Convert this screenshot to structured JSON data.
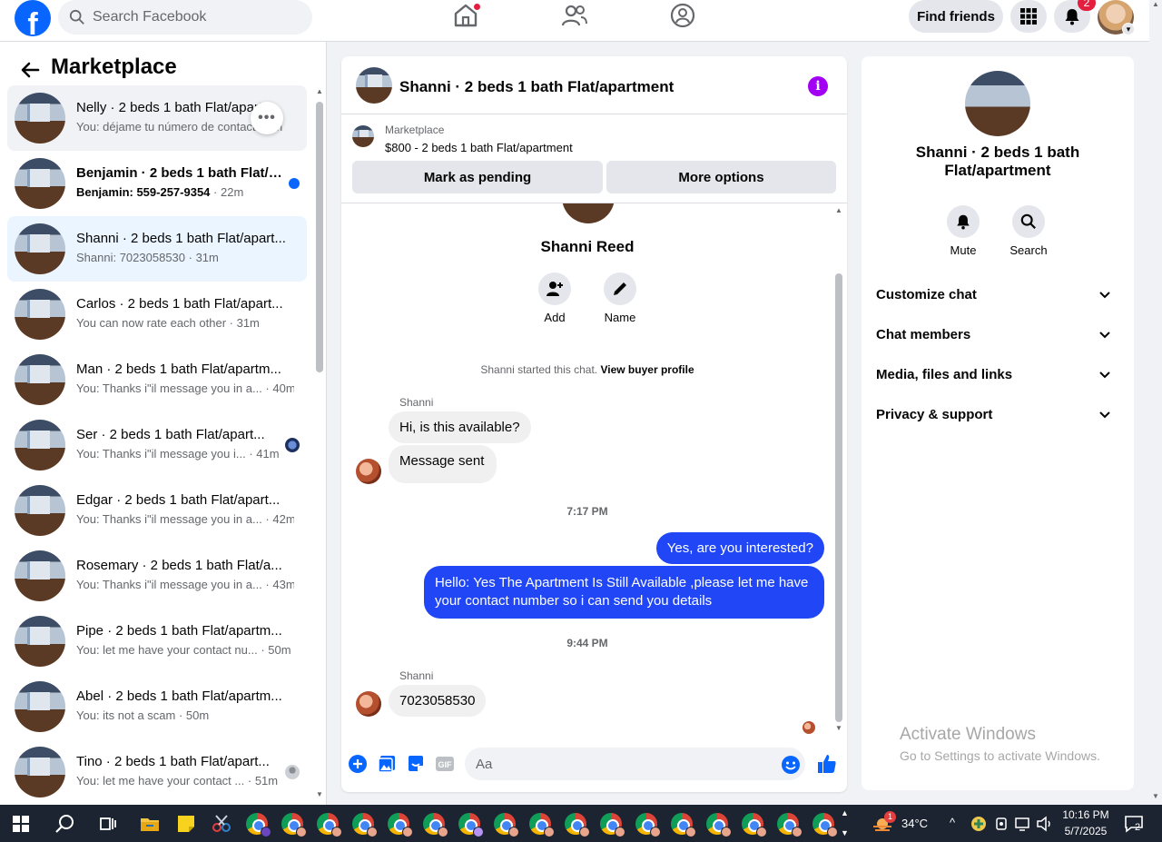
{
  "topnav": {
    "logo_letter": "f",
    "search_placeholder": "Search Facebook",
    "find_friends": "Find friends",
    "notification_count": "2"
  },
  "sidebar": {
    "title": "Marketplace",
    "conversations": [
      {
        "title": "Nelly · 2 beds 1 bath Flat/apartment",
        "preview": "You: déjame tu número de contacto",
        "time": "m",
        "state": "hover"
      },
      {
        "title": "Benjamin · 2 beds 1 bath Flat/apartment",
        "preview": "Benjamin: 559-257-9354",
        "time": "22m",
        "state": "unread"
      },
      {
        "title": "Shanni · 2 beds 1 bath Flat/apart...",
        "preview": "Shanni: 7023058530",
        "time": "31m",
        "state": "active"
      },
      {
        "title": "Carlos · 2 beds 1 bath Flat/apart...",
        "preview": "You can now rate each other",
        "time": "31m",
        "state": ""
      },
      {
        "title": "Man · 2 beds 1 bath Flat/apartm...",
        "preview": "You: Thanks i\"il message you in a...",
        "time": "40m",
        "state": ""
      },
      {
        "title": "Ser · 2 beds 1 bath Flat/apart...",
        "preview": "You: Thanks i\"il message you i...",
        "time": "41m",
        "state": "seen"
      },
      {
        "title": "Edgar · 2 beds 1 bath Flat/apart...",
        "preview": "You: Thanks i\"il message you in a...",
        "time": "42m",
        "state": ""
      },
      {
        "title": "Rosemary · 2 beds 1 bath Flat/a...",
        "preview": "You: Thanks i\"il message you in a...",
        "time": "43m",
        "state": ""
      },
      {
        "title": "Pipe · 2 beds 1 bath Flat/apartm...",
        "preview": "You: let me have your contact nu...",
        "time": "50m",
        "state": ""
      },
      {
        "title": "Abel · 2 beds 1 bath Flat/apartm...",
        "preview": "You: its not a scam",
        "time": "50m",
        "state": ""
      },
      {
        "title": "Tino · 2 beds 1 bath Flat/apart...",
        "preview": "You: let me have your contact ...",
        "time": "51m",
        "state": "seen-gray"
      }
    ]
  },
  "chat": {
    "title": "Shanni · 2 beds 1 bath Flat/apartment",
    "listing_label": "Marketplace",
    "listing_price": "$800 - 2 beds 1 bath Flat/apartment",
    "mark_pending": "Mark as pending",
    "more_options": "More options",
    "profile_name": "Shanni Reed",
    "add_label": "Add",
    "name_label": "Name",
    "system_text": "Shanni started this chat.",
    "system_link": "View buyer profile",
    "sender_name": "Shanni",
    "msg1": "Hi, is this available?",
    "msg2": "Message sent",
    "time1": "7:17 PM",
    "out1": "Yes, are you interested?",
    "out2": "Hello: Yes The Apartment Is Still Available ,please let me have your contact number so i can send you details",
    "time2": "9:44 PM",
    "msg3": "7023058530",
    "composer_placeholder": "Aa"
  },
  "right_panel": {
    "title": "Shanni · 2 beds 1 bath Flat/apartment",
    "mute": "Mute",
    "search": "Search",
    "sections": [
      "Customize chat",
      "Chat members",
      "Media, files and links",
      "Privacy & support"
    ],
    "activate_title": "Activate Windows",
    "activate_sub": "Go to Settings to activate Windows."
  },
  "taskbar": {
    "temperature": "34°C",
    "time": "10:16 PM",
    "date": "5/7/2025",
    "weather_badge": "1",
    "notification_count": "2"
  },
  "colors": {
    "brand": "#0866ff",
    "outgoing_bubble": "#2046f5",
    "info": "#a100f2",
    "badge": "#e41e3f"
  }
}
